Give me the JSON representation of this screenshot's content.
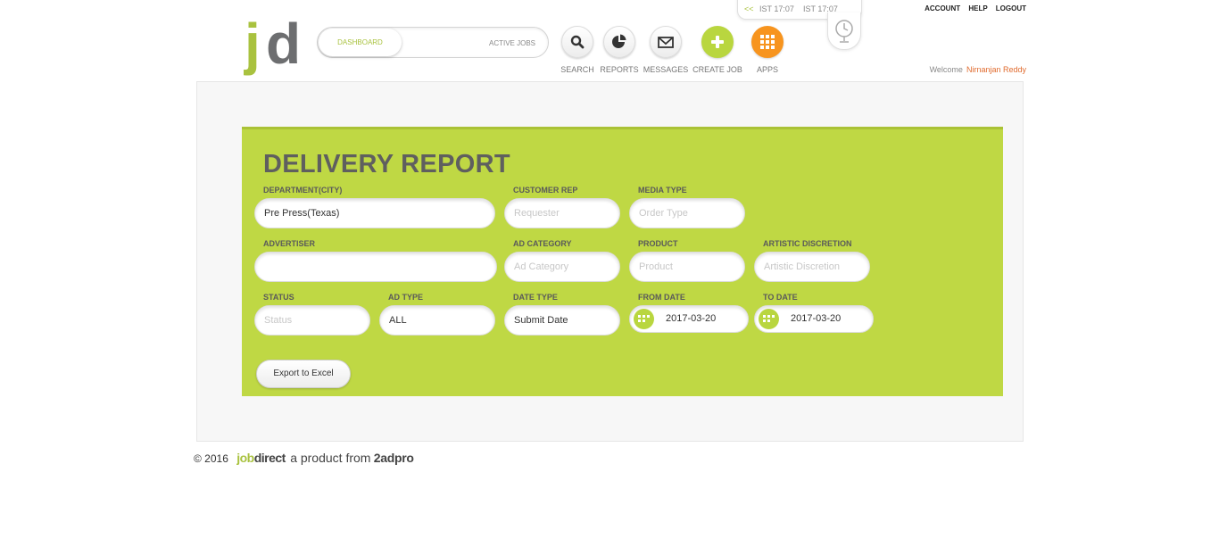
{
  "header": {
    "logo": {
      "part1": "j",
      "part2": "d"
    },
    "switcher": {
      "dashboard": "DASHBOARD",
      "active_jobs": "ACTIVE JOBS"
    },
    "nav": {
      "search": "SEARCH",
      "reports": "REPORTS",
      "messages": "MESSAGES",
      "create_job": "CREATE JOB",
      "apps": "APPS"
    },
    "clock": {
      "arrows": "<<",
      "time1": "IST 17:07",
      "time2": "IST 17:07"
    },
    "links": {
      "account": "ACCOUNT",
      "help": "HELP",
      "logout": "LOGOUT"
    },
    "welcome": {
      "label": "Welcome",
      "user": "Nirnanjan Reddy"
    }
  },
  "report": {
    "title": "DELIVERY REPORT",
    "fields": {
      "department": {
        "label": "DEPARTMENT(CITY)",
        "value": "Pre Press(Texas)"
      },
      "customer_rep": {
        "label": "CUSTOMER REP",
        "placeholder": "Requester"
      },
      "media_type": {
        "label": "MEDIA TYPE",
        "placeholder": "Order Type"
      },
      "advertiser": {
        "label": "ADVERTISER",
        "value": ""
      },
      "ad_category": {
        "label": "AD CATEGORY",
        "placeholder": "Ad Category"
      },
      "product": {
        "label": "PRODUCT",
        "placeholder": "Product"
      },
      "artistic_discretion": {
        "label": "ARTISTIC DISCRETION",
        "placeholder": "Artistic Discretion"
      },
      "status": {
        "label": "STATUS",
        "placeholder": "Status"
      },
      "ad_type": {
        "label": "AD TYPE",
        "value": "ALL"
      },
      "date_type": {
        "label": "DATE TYPE",
        "value": "Submit Date"
      },
      "from_date": {
        "label": "FROM DATE",
        "value": "2017-03-20"
      },
      "to_date": {
        "label": "TO DATE",
        "value": "2017-03-20"
      }
    },
    "export_button": "Export to Excel"
  },
  "footer": {
    "copyright": "© 2016",
    "brand_job": "job",
    "brand_direct": "direct",
    "tagline": "a product from",
    "brand2": "2adpro"
  },
  "colors": {
    "accent_green": "#bfd844",
    "accent_orange": "#f7941e",
    "user_name": "#e06b2e"
  }
}
